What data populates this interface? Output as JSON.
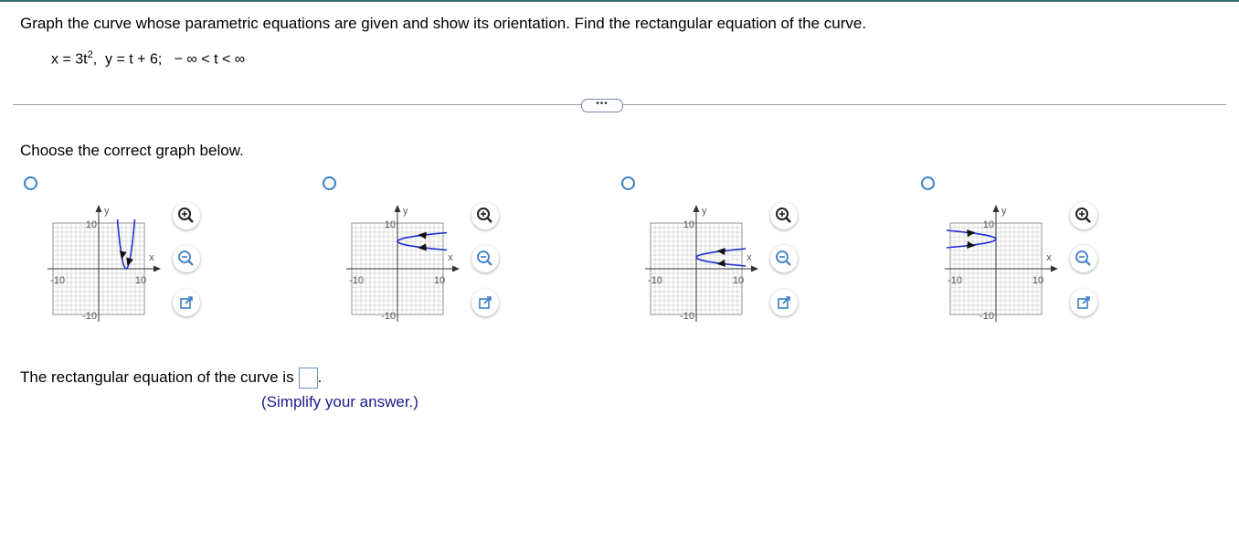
{
  "question": {
    "text": "Graph the curve whose parametric equations are given and show its orientation. Find the rectangular equation of the curve.",
    "eq_x": "x = 3t",
    "eq_exp": "2",
    "eq_rest": ",  y = t + 6;   − ∞ < t < ∞"
  },
  "more_label": "•••",
  "prompt": "Choose the correct graph below.",
  "graph_labels": {
    "y_axis": "y",
    "x_axis": "x",
    "top": "10",
    "bottom": "-10",
    "left": "-10",
    "right": "10"
  },
  "answer": {
    "label": "The rectangular equation of the curve is",
    "value": "",
    "suffix": ".",
    "hint": "(Simplify your answer.)"
  },
  "colors": {
    "accent": "#3a7fc8",
    "curve": "#1f2fd6",
    "hint": "#1a1a8a"
  },
  "icons": [
    "zoom-in-icon",
    "zoom-out-icon",
    "popout-icon"
  ]
}
